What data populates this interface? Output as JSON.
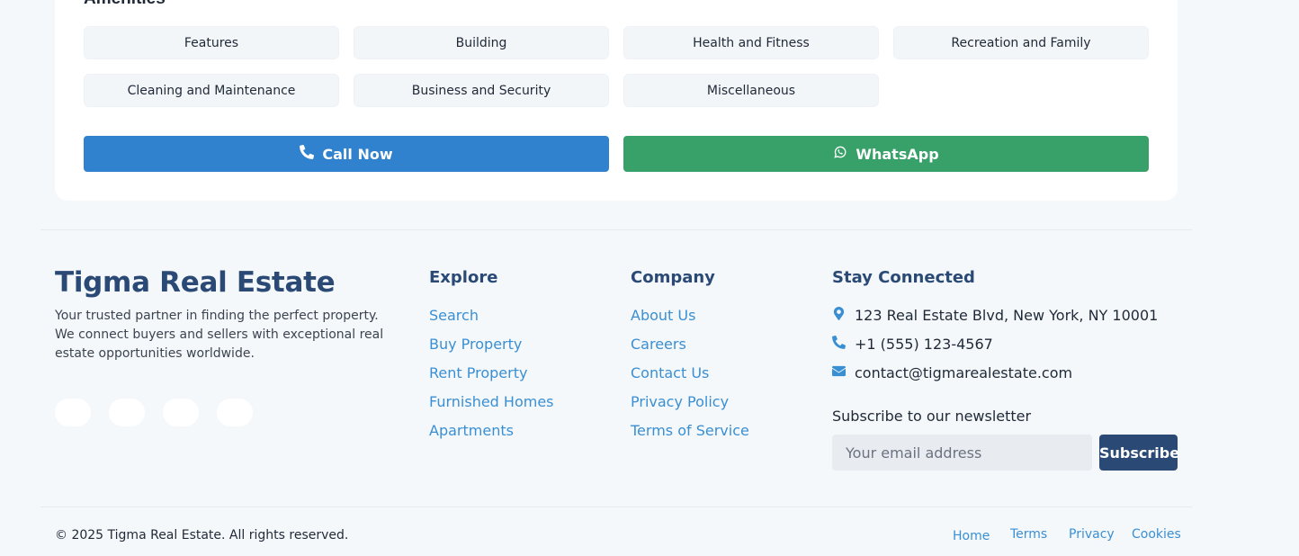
{
  "amenities": {
    "title": "Amenities",
    "items": [
      "Features",
      "Building",
      "Health and Fitness",
      "Recreation and Family",
      "Cleaning and Maintenance",
      "Business and Security",
      "Miscellaneous"
    ]
  },
  "actions": {
    "call_label": "Call Now",
    "whatsapp_label": "WhatsApp",
    "call_color": "#3182ce",
    "whatsapp_color": "#38a169"
  },
  "footer": {
    "brand": "Tigma Real Estate",
    "tagline": "Your trusted partner in finding the perfect property. We connect buyers and sellers with exceptional real estate opportunities worldwide.",
    "social_icons": [
      "facebook-icon",
      "twitter-icon",
      "instagram-icon",
      "linkedin-icon"
    ],
    "explore": {
      "heading": "Explore",
      "links": [
        "Search",
        "Buy Property",
        "Rent Property",
        "Furnished Homes",
        "Apartments"
      ]
    },
    "company": {
      "heading": "Company",
      "links": [
        "About Us",
        "Careers",
        "Contact Us",
        "Privacy Policy",
        "Terms of Service"
      ]
    },
    "stay_connected": {
      "heading": "Stay Connected",
      "address": "123 Real Estate Blvd, New York, NY 10001",
      "phone": "+1 (555) 123-4567",
      "email": "contact@tigmarealestate.com",
      "newsletter_label": "Subscribe to our newsletter",
      "email_placeholder": "Your email address",
      "subscribe_label": "Subscribe"
    },
    "copyright": "© 2025 Tigma Real Estate. All rights reserved.",
    "bottom_links": [
      "Home",
      "Terms",
      "Privacy",
      "Cookies"
    ],
    "brand_color": "#2a4a75",
    "link_color": "#3a8fd3"
  }
}
